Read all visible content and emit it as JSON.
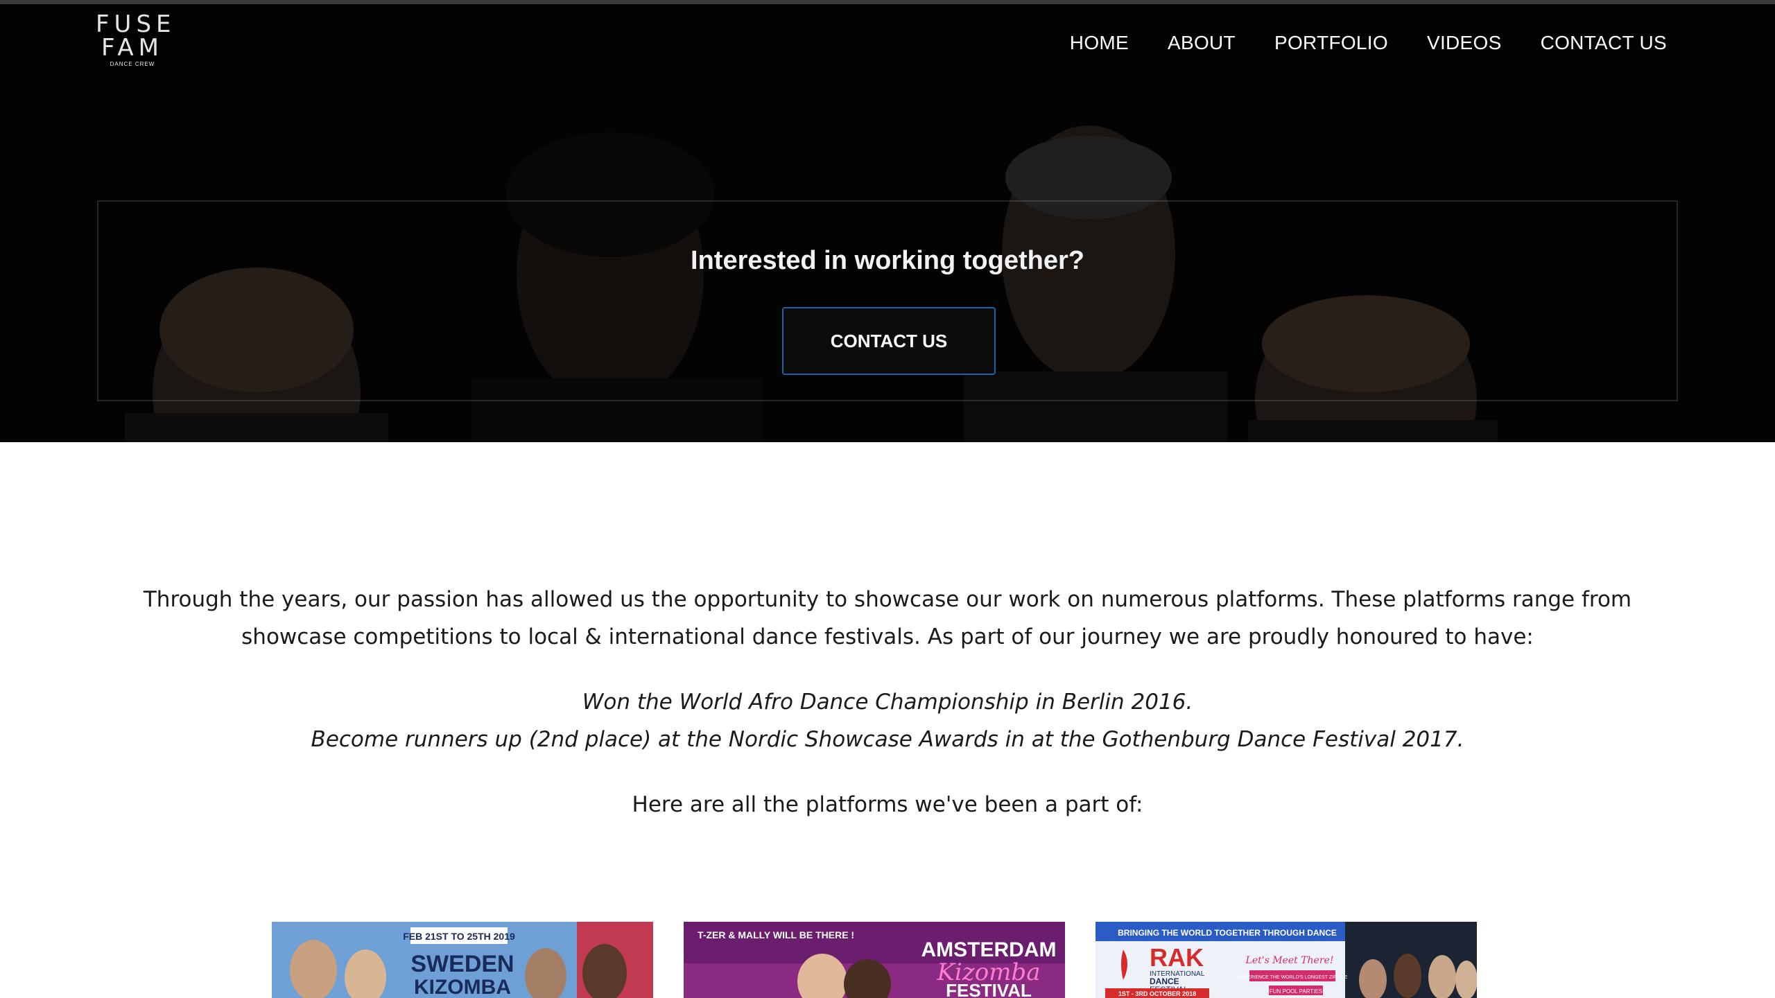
{
  "logo": {
    "line1": "FUSE",
    "line2": "FAM",
    "line3": "DANCE CREW"
  },
  "nav": {
    "items": [
      {
        "label": "HOME"
      },
      {
        "label": "ABOUT"
      },
      {
        "label": "PORTFOLIO"
      },
      {
        "label": "VIDEOS"
      },
      {
        "label": "CONTACT US"
      }
    ]
  },
  "hero": {
    "title": "Interested in working together?",
    "button_label": "CONTACT US"
  },
  "content": {
    "intro": "Through the years, our passion has allowed us the opportunity to showcase our work on numerous platforms. These platforms range from showcase competitions to local & international dance festivals. As part of our journey we are proudly honoured to have:",
    "achievements": [
      "Won the World Afro Dance Championship in Berlin 2016.",
      "Become runners up (2nd place) at the Nordic Showcase Awards in at the Gothenburg Dance Festival 2017."
    ],
    "platforms_intro": "Here are all the platforms we've been a part of:"
  },
  "posters": [
    {
      "texts": [
        "FEB 21ST TO 25TH 2019",
        "SWEDEN",
        "KIZOMBA"
      ],
      "colors": {
        "bg": "#5a8fc6",
        "accent": "#c23a52"
      }
    },
    {
      "texts": [
        "T-ZER & MALLY WILL BE THERE !",
        "AMSTERDAM",
        "Kizomba",
        "FESTIVAL"
      ],
      "colors": {
        "bg": "#6b1d6e",
        "accent": "#d23aa0"
      }
    },
    {
      "texts": [
        "BRINGING THE WORLD TOGETHER THROUGH DANCE",
        "RAK",
        "INTERNATIONAL",
        "DANCE",
        "FESTIVAL",
        "Let's Meet There!",
        "EXPERIENCE THE WORLD'S LONGEST ZIPLINE",
        "FUN POOL PARTIES",
        "1ST - 3RD OCTOBER 2018"
      ],
      "colors": {
        "bg": "#eef2f8",
        "accent": "#d62b2b"
      }
    }
  ]
}
